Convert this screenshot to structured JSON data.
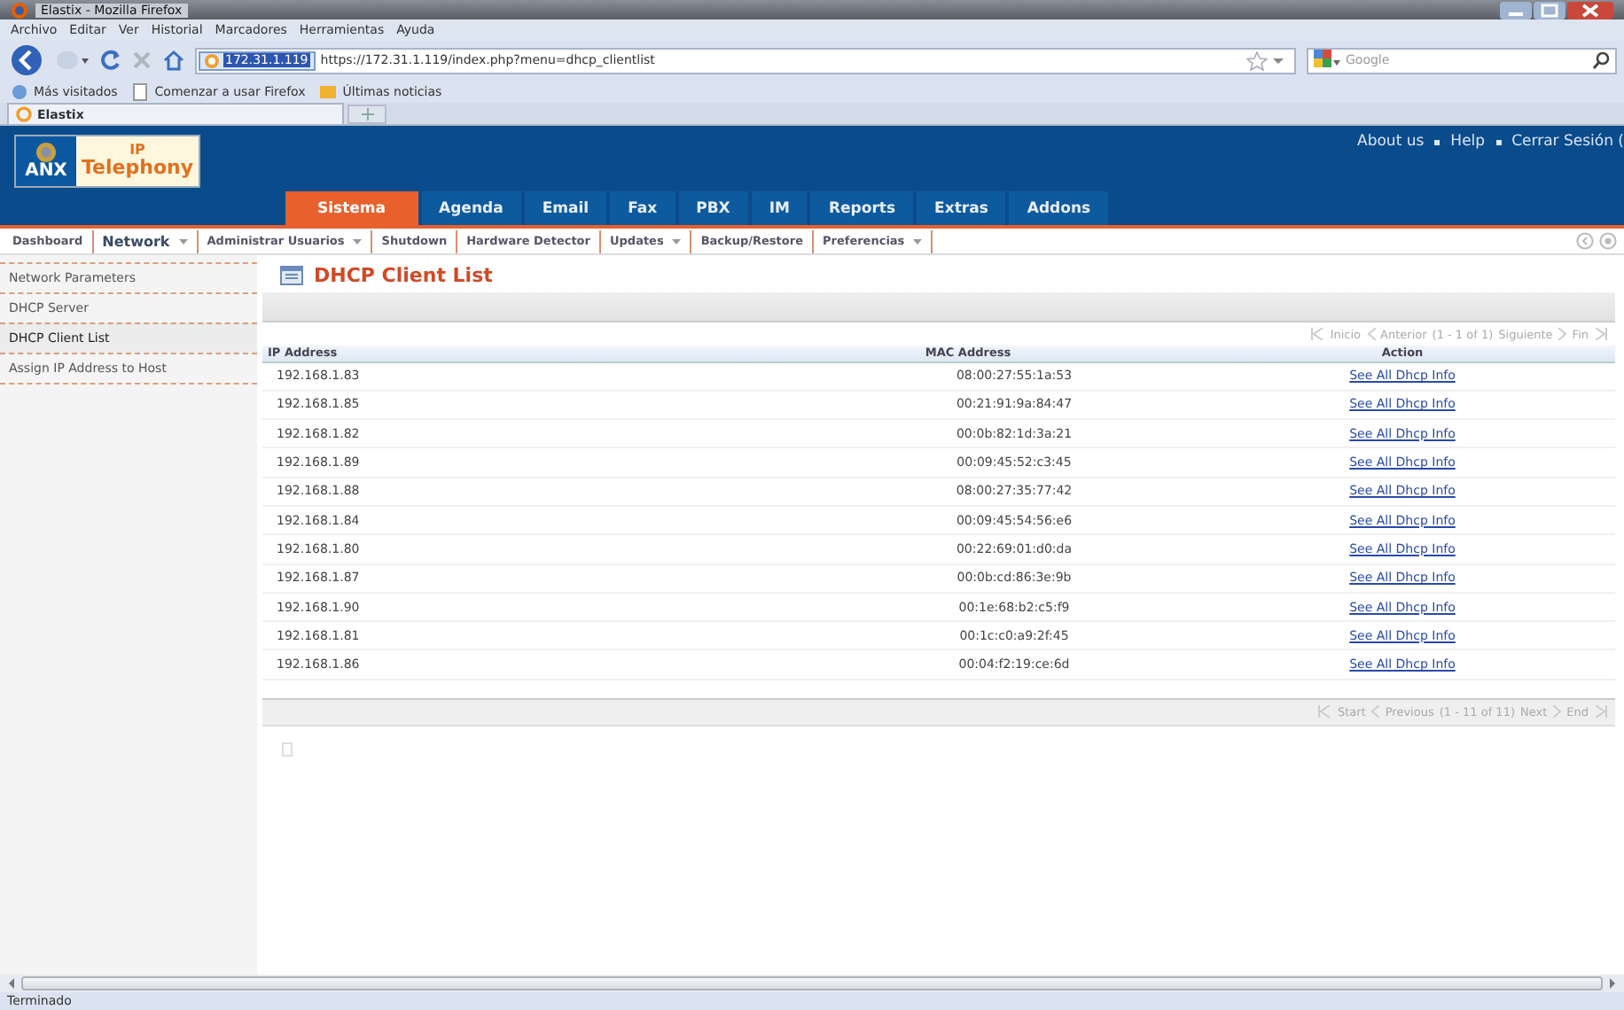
{
  "window": {
    "title": "Elastix - Mozilla Firefox"
  },
  "menu_bar": [
    "Archivo",
    "Editar",
    "Ver",
    "Historial",
    "Marcadores",
    "Herramientas",
    "Ayuda"
  ],
  "address_bar": {
    "site_badge": "172.31.1.119",
    "url": "https://172.31.1.119/index.php?menu=dhcp_clientlist"
  },
  "search": {
    "placeholder": "Google"
  },
  "bookmarks": [
    "Más visitados",
    "Comenzar a usar Firefox",
    "Últimas noticias"
  ],
  "browser_tabs": [
    {
      "label": "Elastix",
      "selected": true
    }
  ],
  "header": {
    "logo_top": "IP",
    "logo_left": "ANX",
    "logo_main": "Telephony",
    "links": [
      "About us",
      "Help",
      "Cerrar Sesión ("
    ]
  },
  "main_tabs": [
    {
      "label": "Sistema",
      "selected": true
    },
    {
      "label": "Agenda",
      "selected": false
    },
    {
      "label": "Email",
      "selected": false
    },
    {
      "label": "Fax",
      "selected": false
    },
    {
      "label": "PBX",
      "selected": false
    },
    {
      "label": "IM",
      "selected": false
    },
    {
      "label": "Reports",
      "selected": false
    },
    {
      "label": "Extras",
      "selected": false
    },
    {
      "label": "Addons",
      "selected": false
    }
  ],
  "sub_menu": [
    {
      "label": "Dashboard",
      "selected": false,
      "has_menu": false
    },
    {
      "label": "Network",
      "selected": true,
      "has_menu": true
    },
    {
      "label": "Administrar Usuarios",
      "selected": false,
      "has_menu": true
    },
    {
      "label": "Shutdown",
      "selected": false,
      "has_menu": false
    },
    {
      "label": "Hardware Detector",
      "selected": false,
      "has_menu": false
    },
    {
      "label": "Updates",
      "selected": false,
      "has_menu": true
    },
    {
      "label": "Backup/Restore",
      "selected": false,
      "has_menu": false
    },
    {
      "label": "Preferencias",
      "selected": false,
      "has_menu": true
    }
  ],
  "sidebar": {
    "items": [
      {
        "label": "Network Parameters",
        "selected": false
      },
      {
        "label": "DHCP Server",
        "selected": false
      },
      {
        "label": "DHCP Client List",
        "selected": true
      },
      {
        "label": "Assign IP Address to Host",
        "selected": false
      }
    ]
  },
  "page_title": "DHCP Client List",
  "top_pager": {
    "start": "Inicio",
    "prev": "Anterior",
    "range": "(1 - 1 of 1)",
    "next": "Siguiente",
    "end": "Fin"
  },
  "table": {
    "columns": [
      "IP Address",
      "MAC Address",
      "Action"
    ],
    "rows": [
      [
        "192.168.1.83",
        "08:00:27:55:1a:53",
        "See All Dhcp Info"
      ],
      [
        "192.168.1.85",
        "00:21:91:9a:84:47",
        "See All Dhcp Info"
      ],
      [
        "192.168.1.82",
        "00:0b:82:1d:3a:21",
        "See All Dhcp Info"
      ],
      [
        "192.168.1.89",
        "00:09:45:52:c3:45",
        "See All Dhcp Info"
      ],
      [
        "192.168.1.88",
        "08:00:27:35:77:42",
        "See All Dhcp Info"
      ],
      [
        "192.168.1.84",
        "00:09:45:54:56:e6",
        "See All Dhcp Info"
      ],
      [
        "192.168.1.80",
        "00:22:69:01:d0:da",
        "See All Dhcp Info"
      ],
      [
        "192.168.1.87",
        "00:0b:cd:86:3e:9b",
        "See All Dhcp Info"
      ],
      [
        "192.168.1.90",
        "00:1e:68:b2:c5:f9",
        "See All Dhcp Info"
      ],
      [
        "192.168.1.81",
        "00:1c:c0:a9:2f:45",
        "See All Dhcp Info"
      ],
      [
        "192.168.1.86",
        "00:04:f2:19:ce:6d",
        "See All Dhcp Info"
      ]
    ]
  },
  "bottom_pager": {
    "start": "Start",
    "prev": "Previous",
    "range": "(1 - 11 of 11)",
    "next": "Next",
    "end": "End"
  },
  "status_bar": "Terminado"
}
